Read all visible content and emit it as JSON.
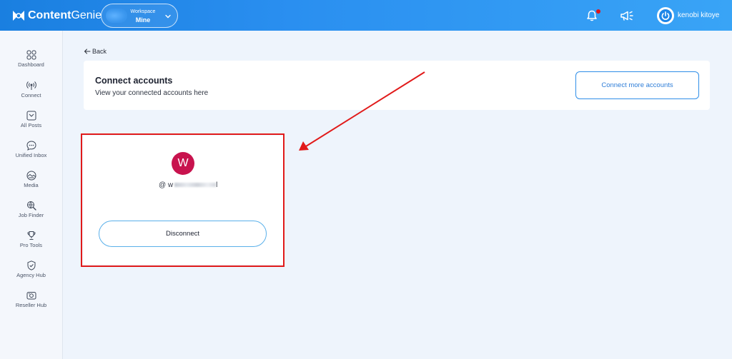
{
  "brand": {
    "name_bold": "Content",
    "name_regular": "Genie"
  },
  "workspace": {
    "label": "Workspace",
    "value": "Mine"
  },
  "user": {
    "name": "kenobi kitoye"
  },
  "sidebar": {
    "items": [
      {
        "label": "Dashboard",
        "icon": "grid-icon"
      },
      {
        "label": "Connect",
        "icon": "broadcast-icon"
      },
      {
        "label": "All Posts",
        "icon": "inbox-icon"
      },
      {
        "label": "Unified Inbox",
        "icon": "chat-bubble-icon"
      },
      {
        "label": "Media",
        "icon": "media-icon"
      },
      {
        "label": "Job Finder",
        "icon": "search-globe-icon"
      },
      {
        "label": "Pro Tools",
        "icon": "trophy-icon"
      },
      {
        "label": "Agency Hub",
        "icon": "shield-check-icon"
      },
      {
        "label": "Reseller Hub",
        "icon": "camera-icon"
      }
    ]
  },
  "page": {
    "back_label": "Back",
    "title": "Connect accounts",
    "subtitle": "View your connected accounts here",
    "connect_more_label": "Connect more accounts"
  },
  "account": {
    "avatar_letter": "W",
    "handle_prefix": "@ w",
    "handle_suffix": "l",
    "disconnect_label": "Disconnect"
  },
  "colors": {
    "topbar": "#2a8ff0",
    "accent": "#2f7ed8",
    "avatar": "#c8134e",
    "annotation": "#e11a1a",
    "notification_dot": "#e0161b"
  }
}
